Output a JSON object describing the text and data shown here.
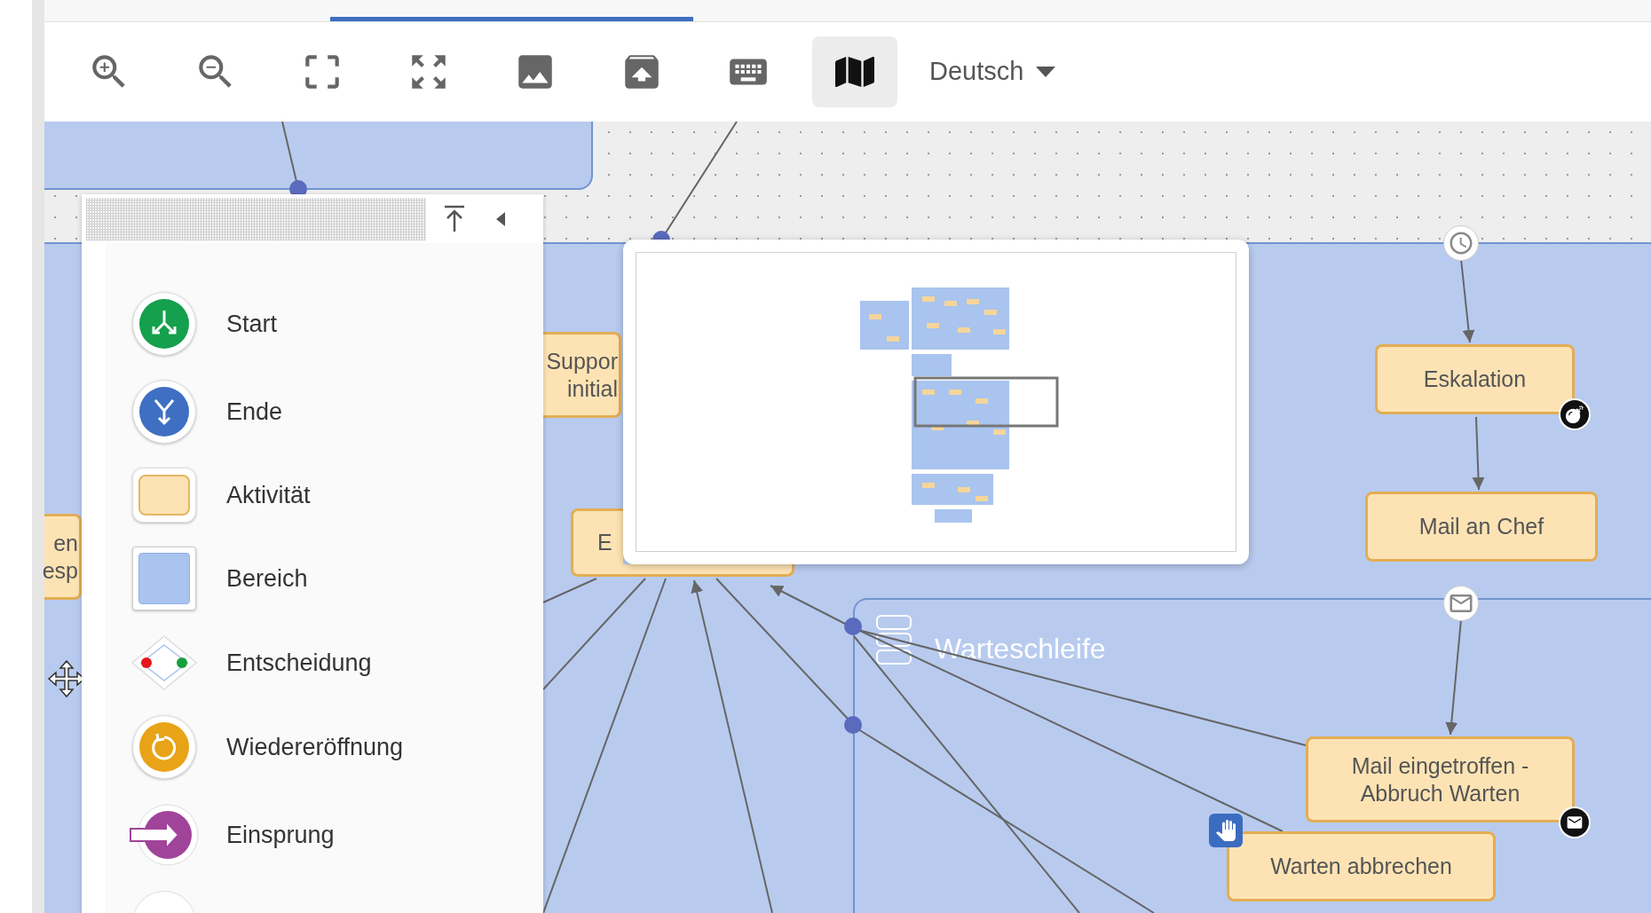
{
  "toolbar": {
    "buttons": [
      {
        "kind": "zoom-in",
        "selected": false
      },
      {
        "kind": "zoom-out",
        "selected": false
      },
      {
        "kind": "frame",
        "selected": false
      },
      {
        "kind": "fit",
        "selected": false
      },
      {
        "kind": "image",
        "selected": false
      },
      {
        "kind": "upload",
        "selected": false
      },
      {
        "kind": "keyboard",
        "selected": false
      },
      {
        "kind": "map",
        "selected": true
      }
    ],
    "language": "Deutsch"
  },
  "palette": {
    "items": [
      {
        "kind": "start",
        "label": "Start"
      },
      {
        "kind": "end",
        "label": "Ende"
      },
      {
        "kind": "activity",
        "label": "Aktivität"
      },
      {
        "kind": "area",
        "label": "Bereich"
      },
      {
        "kind": "decision",
        "label": "Entscheidung"
      },
      {
        "kind": "reopen",
        "label": "Wiedereröffnung"
      },
      {
        "kind": "entry",
        "label": "Einsprung"
      }
    ]
  },
  "canvas": {
    "region_label": "Warteschleife",
    "nodes": [
      {
        "lines": [
          "Suppor",
          "initial"
        ]
      },
      {
        "lines": [
          "en",
          "esp"
        ]
      },
      {
        "lines": [
          "E"
        ]
      },
      {
        "lines": [
          "Eskalation"
        ],
        "badge": {
          "kind": "bomb"
        }
      },
      {
        "lines": [
          "Mail an Chef"
        ]
      },
      {
        "lines": [
          "Mail eingetroffen -",
          "Abbruch Warten"
        ],
        "badge": {
          "kind": "mail"
        }
      },
      {
        "lines": [
          "Warten abbrechen"
        ],
        "badge": {
          "kind": "hand"
        }
      }
    ],
    "events": [
      {
        "kind": "clock"
      },
      {
        "kind": "mail"
      }
    ]
  }
}
